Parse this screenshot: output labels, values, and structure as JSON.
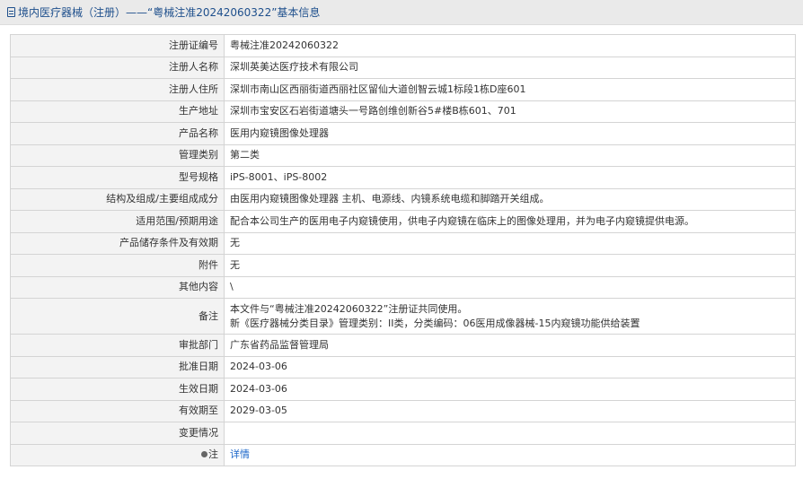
{
  "header": {
    "title": "境内医疗器械（注册）——“粤械注准20242060322”基本信息"
  },
  "rows": [
    {
      "label": "注册证编号",
      "value": "粤械注准20242060322"
    },
    {
      "label": "注册人名称",
      "value": "深圳英美达医疗技术有限公司"
    },
    {
      "label": "注册人住所",
      "value": "深圳市南山区西丽街道西丽社区留仙大道创智云城1标段1栋D座601"
    },
    {
      "label": "生产地址",
      "value": "深圳市宝安区石岩街道塘头一号路创维创新谷5#楼B栋601、701"
    },
    {
      "label": "产品名称",
      "value": "医用内窥镜图像处理器"
    },
    {
      "label": "管理类别",
      "value": "第二类"
    },
    {
      "label": "型号规格",
      "value": "iPS-8001、iPS-8002"
    },
    {
      "label": "结构及组成/主要组成成分",
      "value": "由医用内窥镜图像处理器 主机、电源线、内镜系统电缆和脚踏开关组成。"
    },
    {
      "label": "适用范围/预期用途",
      "value": "配合本公司生产的医用电子内窥镜使用，供电子内窥镜在临床上的图像处理用，并为电子内窥镜提供电源。"
    },
    {
      "label": "产品储存条件及有效期",
      "value": "无"
    },
    {
      "label": "附件",
      "value": "无"
    },
    {
      "label": "其他内容",
      "value": "\\"
    },
    {
      "label": "备注",
      "value_line1": "本文件与“粤械注准20242060322”注册证共同使用。",
      "value_line2": "新《医疗器械分类目录》管理类别：II类，分类编码：06医用成像器械-15内窥镜功能供给装置"
    },
    {
      "label": "审批部门",
      "value": "广东省药品监督管理局"
    },
    {
      "label": "批准日期",
      "value": "2024-03-06"
    },
    {
      "label": "生效日期",
      "value": "2024-03-06"
    },
    {
      "label": "有效期至",
      "value": "2029-03-05"
    },
    {
      "label": "变更情况",
      "value": ""
    },
    {
      "label": "注",
      "value": "详情"
    }
  ],
  "colors": {
    "header_text": "#1e4f8c",
    "link": "#1a66c9",
    "label_bg": "#f3f3f3",
    "border": "#d4d4d4"
  }
}
